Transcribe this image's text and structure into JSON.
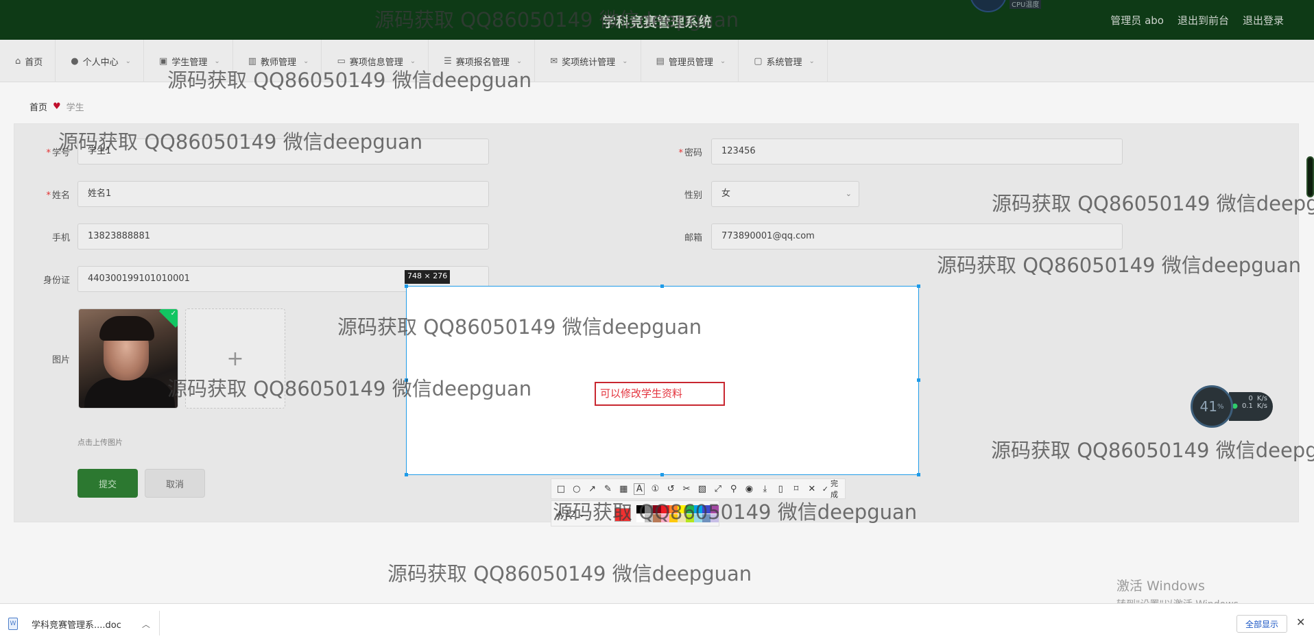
{
  "header": {
    "title": "学科竞赛管理系统",
    "cpu_label": "CPU温度",
    "links": [
      "管理员 abo",
      "退出到前台",
      "退出登录"
    ]
  },
  "nav": [
    {
      "label": "首页",
      "icon": "home-icon",
      "has_menu": false
    },
    {
      "label": "个人中心",
      "icon": "user-icon",
      "has_menu": true
    },
    {
      "label": "学生管理",
      "icon": "id-card-icon",
      "has_menu": true
    },
    {
      "label": "教师管理",
      "icon": "bar-chart-icon",
      "has_menu": true
    },
    {
      "label": "赛项信息管理",
      "icon": "monitor-icon",
      "has_menu": true
    },
    {
      "label": "赛项报名管理",
      "icon": "list-icon",
      "has_menu": true
    },
    {
      "label": "奖项统计管理",
      "icon": "mail-icon",
      "has_menu": true
    },
    {
      "label": "管理员管理",
      "icon": "books-icon",
      "has_menu": true
    },
    {
      "label": "系统管理",
      "icon": "chat-icon",
      "has_menu": true
    }
  ],
  "breadcrumb": {
    "home": "首页",
    "current": "学生"
  },
  "form": {
    "student_no": {
      "label": "学号",
      "value": "学生1"
    },
    "password": {
      "label": "密码",
      "value": "123456"
    },
    "name": {
      "label": "姓名",
      "value": "姓名1"
    },
    "gender": {
      "label": "性别",
      "value": "女"
    },
    "phone": {
      "label": "手机",
      "value": "13823888881"
    },
    "email": {
      "label": "邮箱",
      "value": "773890001@qq.com"
    },
    "id_card": {
      "label": "身份证",
      "value": "440300199101010001"
    },
    "photo": {
      "label": "图片",
      "upload_plus": "+",
      "hint": "点击上传图片"
    },
    "submit": "提交",
    "cancel": "取消"
  },
  "capture": {
    "size_label": "748 × 276",
    "annotation_text": "可以修改学生资料",
    "toolbar_done": "完成",
    "font_size": "12"
  },
  "palette_colors": [
    "#000000",
    "#7f7f7f",
    "#880015",
    "#ed1c24",
    "#ff7f27",
    "#fff200",
    "#22b14c",
    "#00a2e8",
    "#3f48cc",
    "#a349a4",
    "#ffffff",
    "#c3c3c3",
    "#b97a57",
    "#ffaec9",
    "#ffc90e",
    "#efe4b0",
    "#b5e61d",
    "#99d9ea",
    "#7092be",
    "#c8bfe7"
  ],
  "watermark": "源码获取 QQ86050149 微信deepguan",
  "system": {
    "gauge": "41",
    "gauge_unit": "%",
    "net_up": "0",
    "net_down": "0.1",
    "net_unit": "K/s",
    "activate_title": "激活 Windows",
    "activate_sub": "转到\"设置\"以激活 Windows。"
  },
  "download": {
    "file": "学科竞赛管理系....doc",
    "show_all": "全部显示"
  }
}
